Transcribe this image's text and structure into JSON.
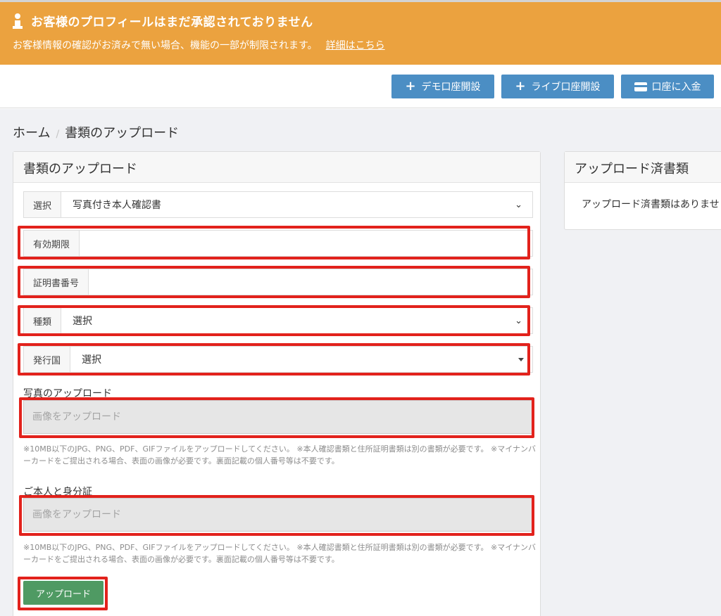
{
  "alert": {
    "title": "お客様のプロフィールはまだ承認されておりません",
    "message": "お客様情報の確認がお済みで無い場合、機能の一部が制限されます。",
    "link": "詳細はこちら"
  },
  "toolbar": {
    "demo_account": "デモ口座開設",
    "live_account": "ライブ口座開設",
    "deposit": "口座に入金"
  },
  "breadcrumb": {
    "home": "ホーム",
    "separator": "/",
    "current": "書類のアップロード"
  },
  "form": {
    "title": "書類のアップロード",
    "doc_select_label": "選択",
    "doc_select_value": "写真付き本人確認書",
    "expiry_label": "有効期限",
    "expiry_value": "",
    "cert_number_label": "証明書番号",
    "cert_number_value": "",
    "type_label": "種類",
    "type_value": "選択",
    "country_label": "発行国",
    "country_value": "選択",
    "photo_upload_label": "写真のアップロード",
    "photo_upload_placeholder": "画像をアップロード",
    "help_text_1": "※10MB以下のJPG、PNG、PDF、GIFファイルをアップロードしてください。 ※本人確認書類と住所証明書類は別の書類が必要です。 ※マイナンバーカードをご提出される場合、表面の画像が必要です。裏面記載の個人番号等は不要です。",
    "selfie_label": "ご本人と身分証",
    "selfie_placeholder": "画像をアップロード",
    "help_text_2": "※10MB以下のJPG、PNG、PDF、GIFファイルをアップロードしてください。 ※本人確認書類と住所証明書類は別の書類が必要です。 ※マイナンバーカードをご提出される場合、表面の画像が必要です。裏面記載の個人番号等は不要です。",
    "submit": "アップロード"
  },
  "uploaded": {
    "title": "アップロード済書類",
    "empty_message": "アップロード済書類はありませ"
  },
  "colors": {
    "alert_bg": "#eba23f",
    "button_blue": "#4b8ec4",
    "button_green": "#4f9a63",
    "highlight_red": "#e2221c"
  }
}
